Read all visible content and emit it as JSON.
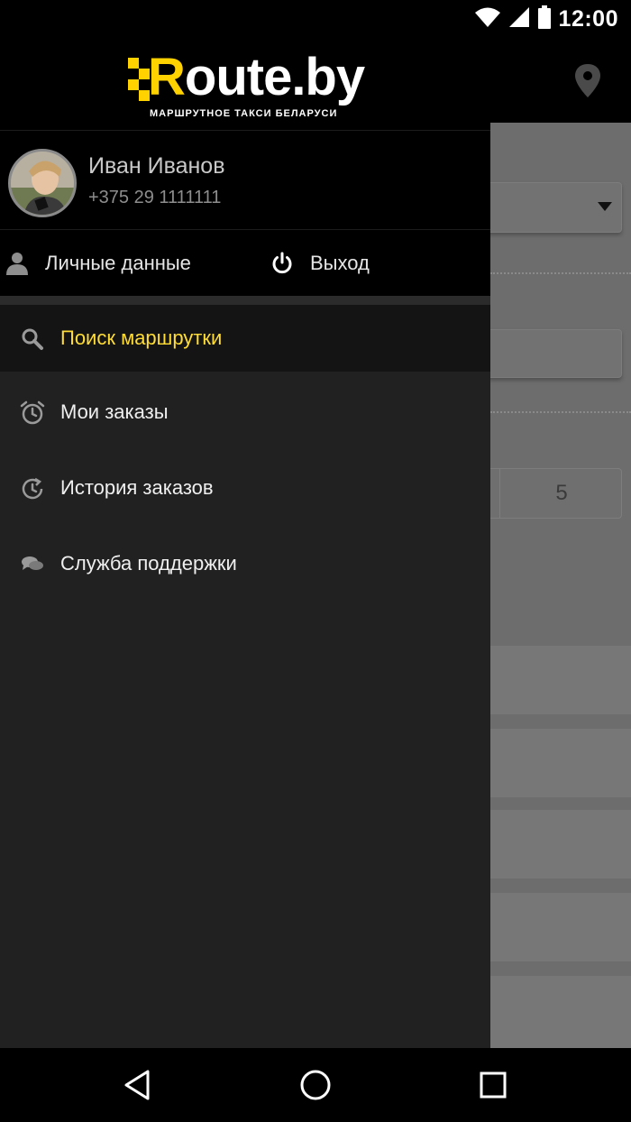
{
  "status_bar": {
    "time": "12:00",
    "icons": [
      "wifi-icon",
      "signal-icon",
      "battery-icon"
    ]
  },
  "app": {
    "logo_text": "Route.by",
    "logo_tagline": "МАРШРУТНОЕ ТАКСИ БЕЛАРУСИ",
    "brand_color": "#ffd200"
  },
  "user": {
    "name": "Иван Иванов",
    "phone": "+375 29 1111111"
  },
  "header_actions": {
    "profile_label": "Личные данные",
    "logout_label": "Выход"
  },
  "menu": {
    "active_color": "#ffdd36",
    "items": [
      {
        "label": "Поиск маршрутки",
        "icon": "search-icon",
        "active": true
      },
      {
        "label": "Мои заказы",
        "icon": "alarm-clock-icon",
        "active": false
      },
      {
        "label": "История заказов",
        "icon": "history-icon",
        "active": false
      },
      {
        "label": "Служба поддержки",
        "icon": "chat-bubbles-icon",
        "active": false
      }
    ]
  },
  "background_screen": {
    "passenger_count": "5"
  },
  "nav_bar": {
    "buttons": [
      "back-icon",
      "home-icon",
      "recents-icon"
    ]
  }
}
